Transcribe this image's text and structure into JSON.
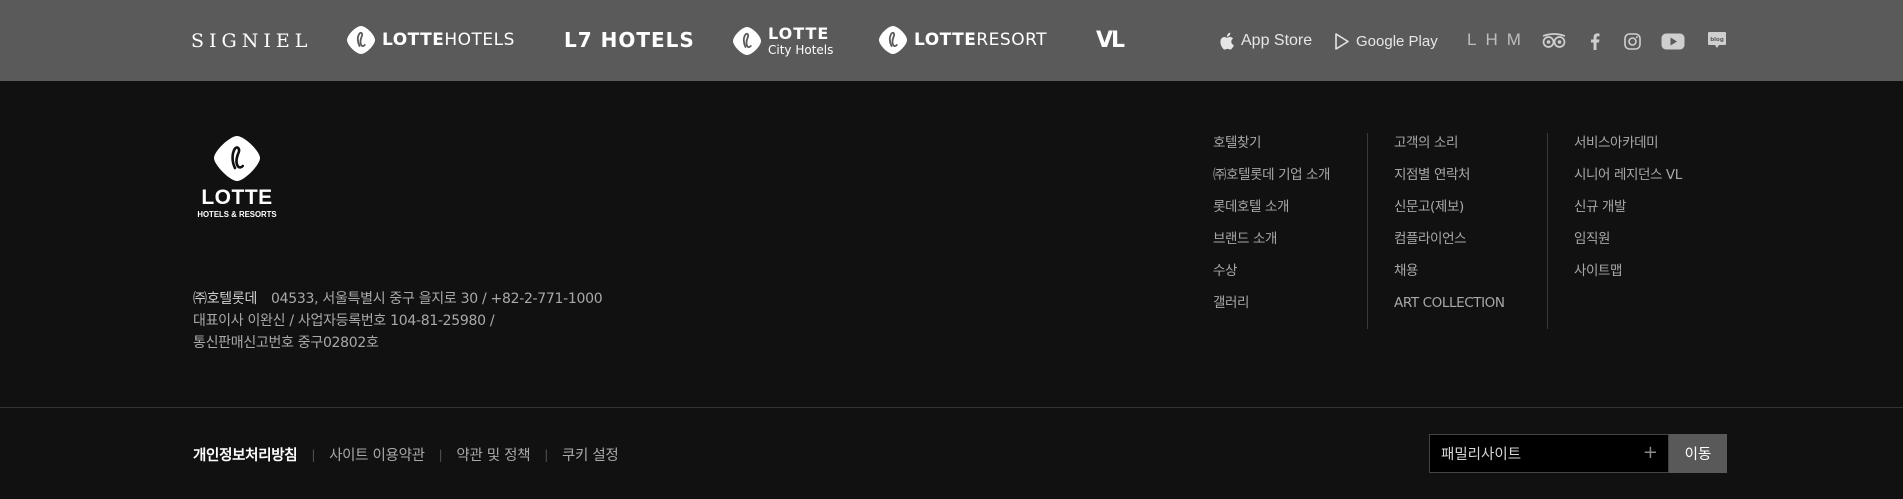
{
  "brands": {
    "signiel": "SIGNIEL",
    "lotte_hotels": {
      "bold": "LOTTE",
      "rest": " HOTELS"
    },
    "l7": "L7 HOTELS",
    "city_hotels": {
      "line1": "LOTTE",
      "line2": "City Hotels"
    },
    "lotte_resort": {
      "bold": "LOTTE",
      "rest": " RESORT"
    },
    "vl": "VL"
  },
  "stores": {
    "app_store": "App Store",
    "google_play": "Google Play"
  },
  "lhm": "LHM",
  "sns_icons": [
    "tripadvisor-icon",
    "facebook-icon",
    "instagram-icon",
    "youtube-icon",
    "blog-icon"
  ],
  "sns": {
    "blog_label": "blog"
  },
  "footer": {
    "logo": {
      "word": "LOTTE",
      "sub": "HOTELS & RESORTS"
    },
    "company": {
      "name": "㈜호텔롯데",
      "address": "04533, 서울특별시 중구 을지로 30 / +82-2-771-1000",
      "line2": "대표이사 이완신 / 사업자등록번호 104-81-25980 /",
      "line3": "통신판매신고번호 중구02802호"
    },
    "links_col1": [
      "호텔찾기",
      "㈜호텔롯데 기업 소개",
      "롯데호텔 소개",
      "브랜드 소개",
      "수상",
      "갤러리"
    ],
    "links_col2": [
      "고객의 소리",
      "지점별 연락처",
      "신문고(제보)",
      "컴플라이언스",
      "채용",
      "ART COLLECTION"
    ],
    "links_col3": [
      "서비스아카데미",
      "시니어 레지던스 VL",
      "신규 개발",
      "임직원",
      "사이트맵"
    ],
    "policy": [
      "개인정보처리방침",
      "사이트 이용약관",
      "약관 및 정책",
      "쿠키 설정"
    ],
    "family_site": {
      "label": "패밀리사이트",
      "plus": "+",
      "go": "이동"
    }
  },
  "colors": {
    "brandbar_bg": "#5a5a5a",
    "footer_bg": "#111111",
    "go_button_bg": "#595959"
  }
}
